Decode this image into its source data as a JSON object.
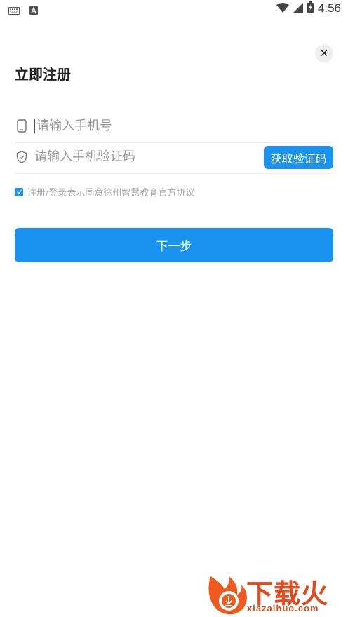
{
  "status_bar": {
    "time": "4:56",
    "icons": [
      "keyboard-icon",
      "a-icon",
      "wifi-icon",
      "signal-icon",
      "battery-icon"
    ]
  },
  "page": {
    "title": "立即注册",
    "close_icon": "close-icon",
    "close_glyph": "✕"
  },
  "form": {
    "phone_placeholder": "请输入手机号",
    "code_placeholder": "请输入手机验证码",
    "get_code_label": "获取验证码",
    "agree_text": "注册/登录表示同意",
    "agree_link": "徐州智慧教育官方协议",
    "agree_checked": true,
    "next_label": "下一步"
  },
  "watermark": {
    "brand": "下载火",
    "url": "xiazaihuo.com"
  },
  "colors": {
    "accent": "#1a92f0",
    "watermark": "#e24b1d"
  }
}
